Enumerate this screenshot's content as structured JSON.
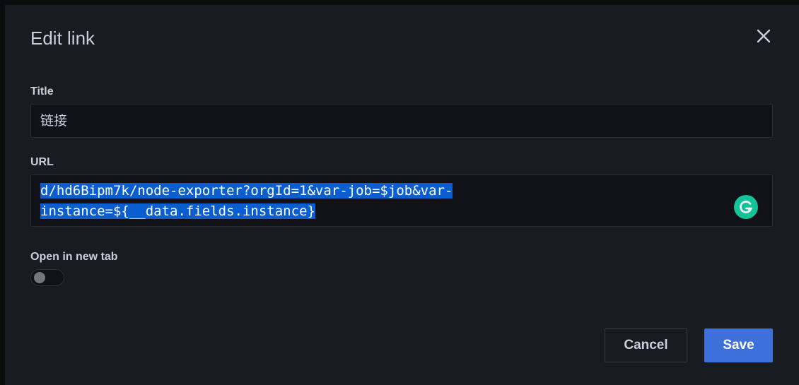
{
  "dialog": {
    "title": "Edit link",
    "close_icon": "close-icon"
  },
  "fields": {
    "title_label": "Title",
    "title_value": "链接",
    "url_label": "URL",
    "url_value": "d/hd6Bipm7k/node-exporter?orgId=1&var-job=$job&var-instance=${__data.fields.instance}",
    "url_line1": "d/hd6Bipm7k/node-exporter?orgId=1&var-job=$job&var-",
    "url_line2": "instance=${__data.fields.instance}",
    "grammarly_icon": "grammarly-icon",
    "new_tab_label": "Open in new tab",
    "new_tab_enabled": false
  },
  "actions": {
    "cancel_label": "Cancel",
    "save_label": "Save"
  },
  "colors": {
    "background": "#181b1f",
    "input_background": "#111217",
    "primary": "#3d71d9",
    "selection": "#0b5ed0",
    "grammarly": "#15c39a"
  }
}
